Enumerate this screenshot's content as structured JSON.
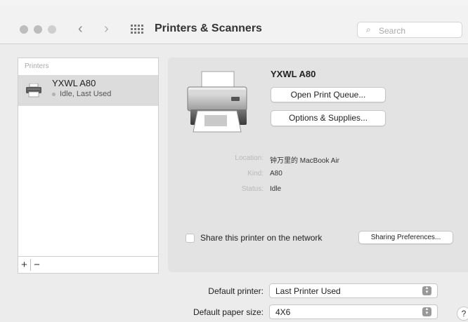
{
  "window": {
    "title": "Printers & Scanners",
    "search": {
      "placeholder": "Search",
      "value": ""
    }
  },
  "sidebar": {
    "header": "Printers",
    "printers": [
      {
        "name": "YXWL A80",
        "status": "Idle, Last Used"
      }
    ],
    "add_label": "+",
    "remove_label": "−"
  },
  "detail": {
    "printer_name": "YXWL A80",
    "open_queue_label": "Open Print Queue...",
    "options_label": "Options & Supplies...",
    "info": {
      "location_label": "Location:",
      "location_value": "钟万里的 MacBook Air",
      "kind_label": "Kind:",
      "kind_value": "A80",
      "status_label": "Status:",
      "status_value": "Idle"
    },
    "share_label": "Share this printer on the network",
    "share_checked": false,
    "sharing_prefs_label": "Sharing Preferences..."
  },
  "footer": {
    "default_printer_label": "Default printer:",
    "default_printer_value": "Last Printer Used",
    "default_paper_label": "Default paper size:",
    "default_paper_value": "4X6",
    "help_label": "?"
  },
  "icons": {
    "traffic": [
      "close-icon",
      "minimize-icon",
      "zoom-icon"
    ],
    "back": "chevron-left-icon",
    "forward": "chevron-right-icon",
    "grid": "grid-icon",
    "search": "search-icon",
    "printer": "printer-icon"
  }
}
